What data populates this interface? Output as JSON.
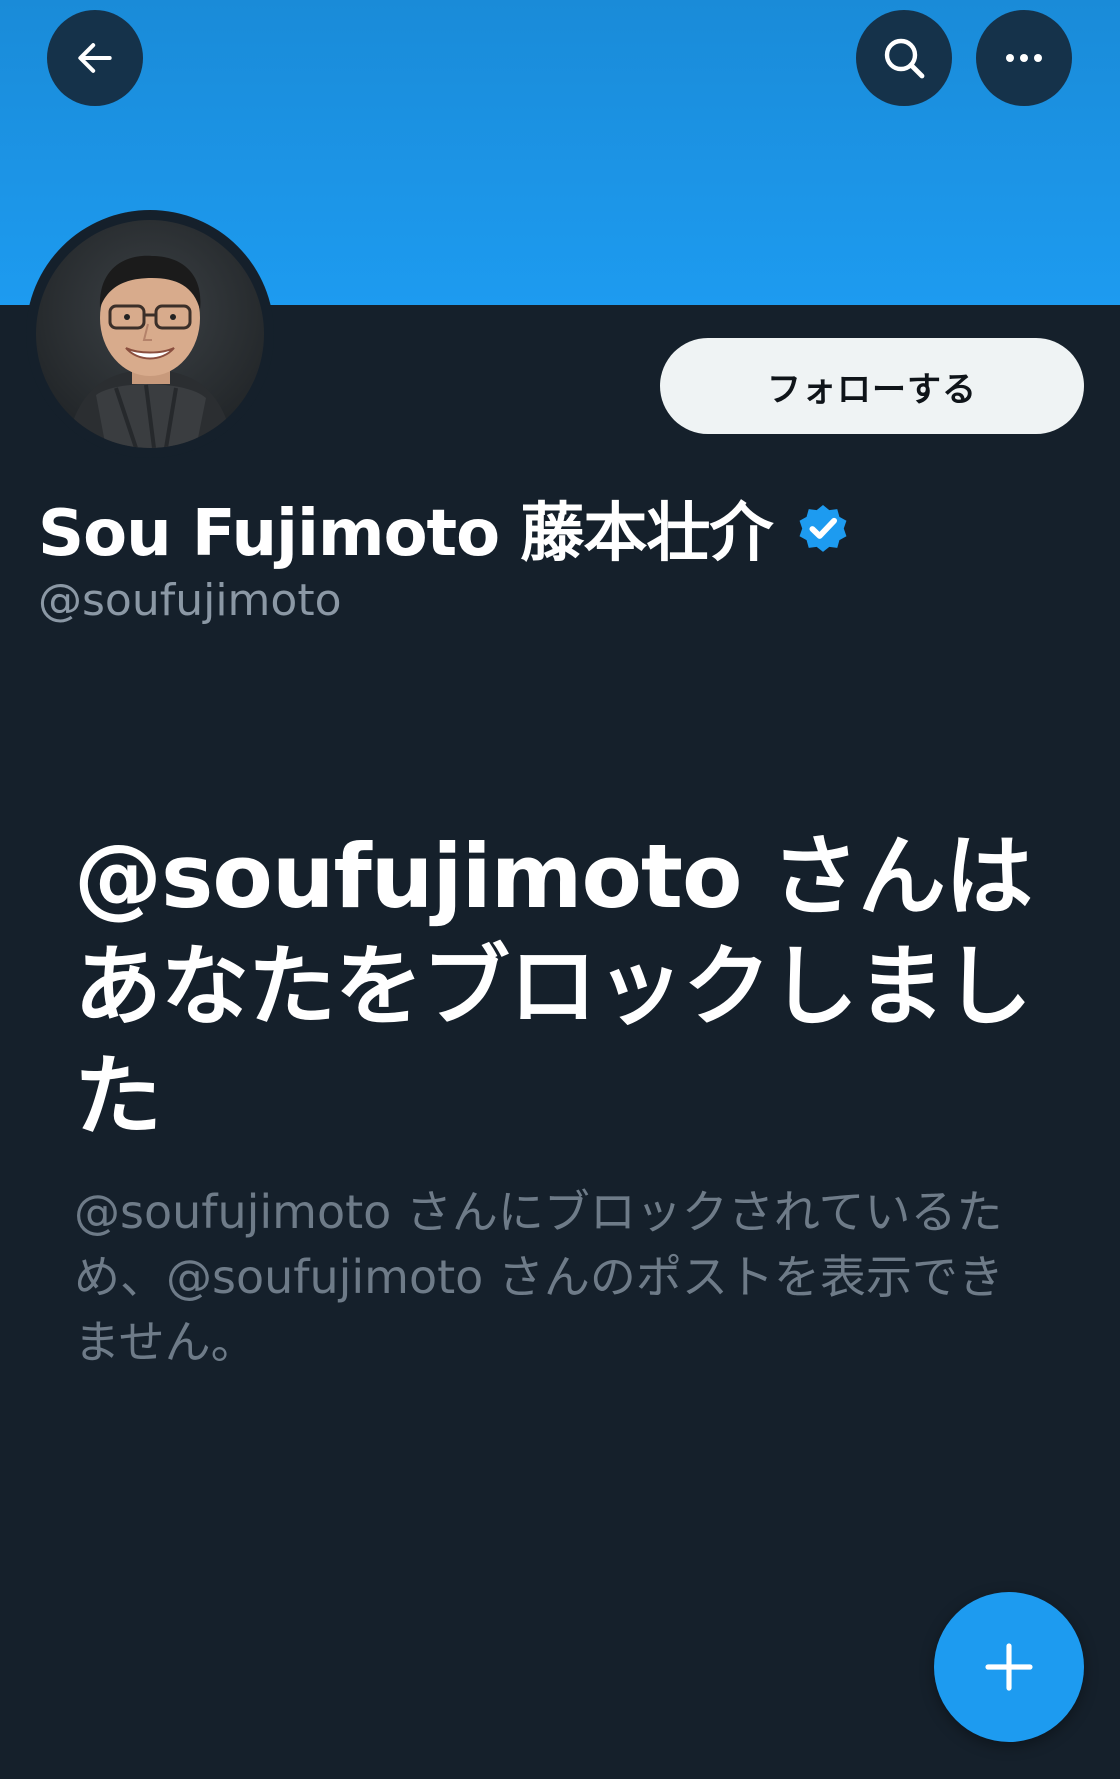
{
  "header": {
    "back_icon": "arrow-left-icon",
    "search_icon": "search-icon",
    "more_icon": "more-horizontal-icon",
    "banner_color": "#1d9bf0"
  },
  "profile": {
    "display_name": "Sou Fujimoto 藤本壮介",
    "handle": "@soufujimoto",
    "verified_icon": "verified-badge-icon",
    "verified_color": "#1d9bf0",
    "follow_label": "フォローする"
  },
  "blocked": {
    "title": "@soufujimoto さんはあなたをブロックしました",
    "description": "@soufujimoto さんにブロックされているため、@soufujimoto さんのポストを表示できません。"
  },
  "fab": {
    "icon": "plus-icon",
    "color": "#1d9bf0"
  }
}
